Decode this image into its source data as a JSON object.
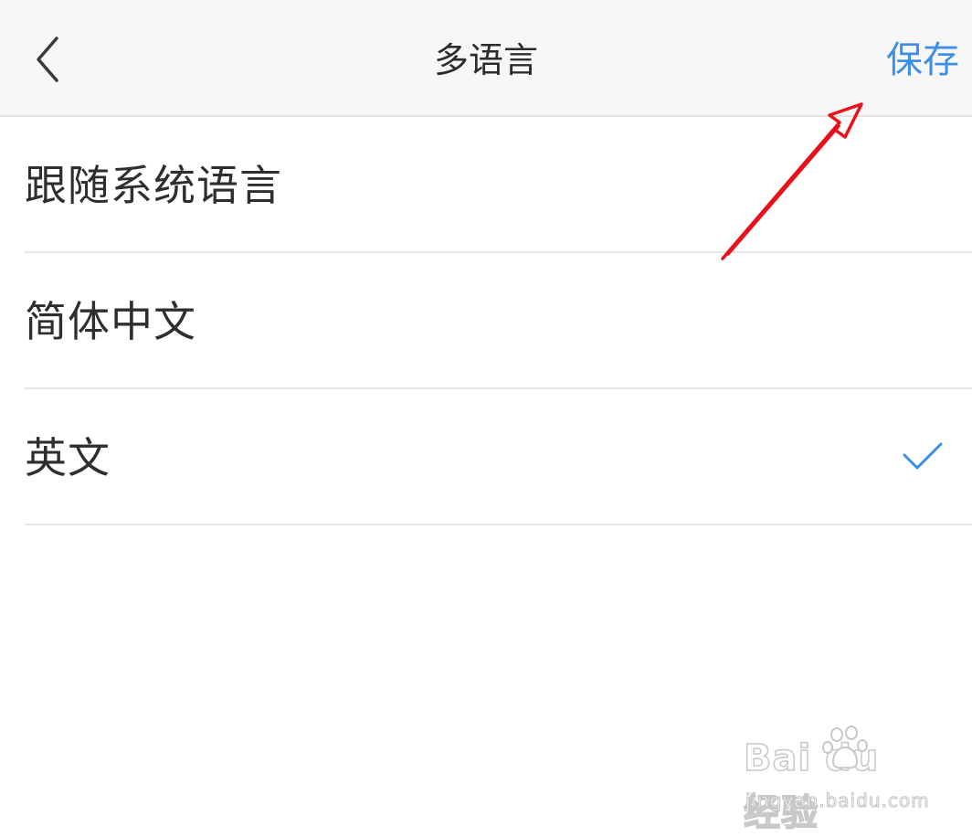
{
  "header": {
    "title": "多语言",
    "save_label": "保存",
    "back_icon": "chevron-left-icon"
  },
  "languages": {
    "items": [
      {
        "label": "跟随系统语言",
        "selected": false
      },
      {
        "label": "简体中文",
        "selected": false
      },
      {
        "label": "英文",
        "selected": true
      }
    ]
  },
  "colors": {
    "accent": "#3d8fe6",
    "annotation_arrow": "#e8111b",
    "nav_background": "#f7f7f7"
  },
  "watermark": {
    "logo_text": "Bai du 经验",
    "url": "jingyan.baidu.com"
  }
}
